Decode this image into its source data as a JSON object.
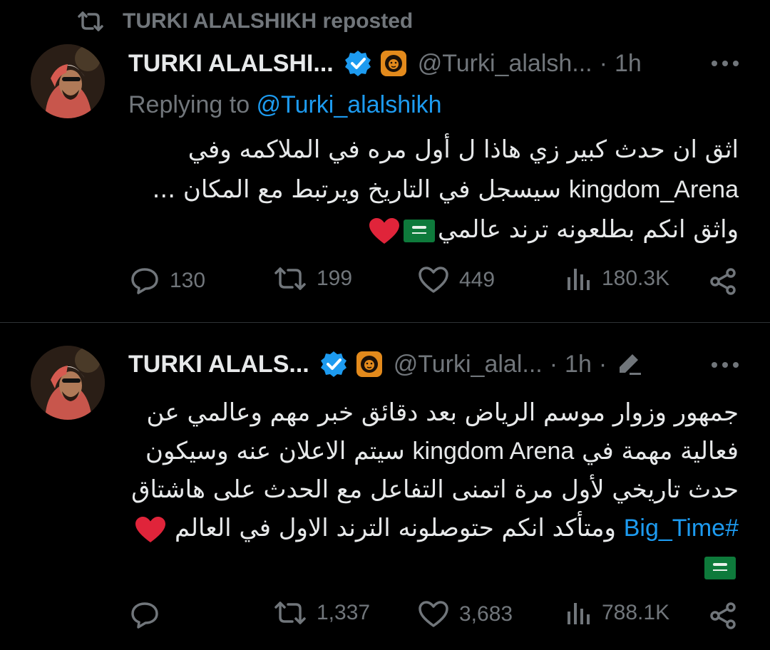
{
  "repost_banner": {
    "text": "TURKI ALALSHIKH reposted"
  },
  "tweets": [
    {
      "name": "TURKI ALALSHI...",
      "handle": "@Turki_alalsh...",
      "dot": "·",
      "time": "1h",
      "replying_prefix": "Replying to ",
      "replying_handle": "@Turki_alalshikh",
      "line1": "اثق ان حدث كبير زي هاذا ل أول مره في الملاكمه وفي",
      "line2_en": "kingdom_Arena",
      "line2_ar": " سيسجل في التاريخ ويرتبط مع المكان ...",
      "line3": "واثق انكم بطلعونه ترند عالمي",
      "stats": {
        "replies": "130",
        "reposts": "199",
        "likes": "449",
        "views": "180.3K"
      }
    },
    {
      "name": "TURKI ALALS...",
      "handle": "@Turki_alal...",
      "dot": "·",
      "time": "1h",
      "time_dot": "·",
      "line1": "جمهور وزوار موسم الرياض بعد دقائق خبر مهم وعالمي عن",
      "line2_ar1": "فعالية مهمة في ",
      "line2_en": "kingdom Arena",
      "line2_ar2": " سيتم الاعلان عنه وسيكون",
      "line3": "حدث تاريخي لأول مرة اتمنى التفاعل مع الحدث على هاشتاق",
      "line4_tag": "#Big_Time",
      "line4_ar": " ومتأكد انكم حتوصلونه الترند الاول في العالم ",
      "stats": {
        "reposts": "1,337",
        "likes": "3,683",
        "views": "788.1K"
      }
    }
  ],
  "colors": {
    "background": "#000000",
    "text": "#e7e9ea",
    "muted": "#71767b",
    "link": "#1d9bf0",
    "verified": "#1d9bf0",
    "heart": "#e0243a",
    "flag": "#0e7a3b"
  },
  "icons": [
    "repost-icon",
    "verified-badge-icon",
    "lion-logo-icon",
    "more-icon",
    "reply-icon",
    "like-icon",
    "views-icon",
    "share-icon",
    "edit-pencil-icon",
    "saudi-flag-icon",
    "red-heart-icon"
  ]
}
